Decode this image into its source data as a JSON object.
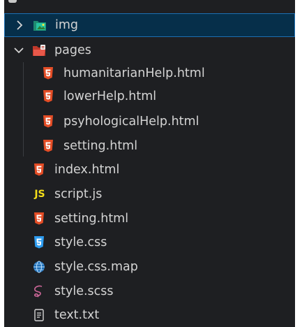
{
  "explorer": {
    "items": [
      {
        "label": "img",
        "type": "folder",
        "state": "collapsed",
        "icon": "image-folder-icon",
        "selected": true
      },
      {
        "label": "pages",
        "type": "folder",
        "state": "expanded",
        "icon": "pages-folder-icon"
      },
      {
        "label": "humanitarianHelp.html",
        "type": "file",
        "icon": "html5-icon"
      },
      {
        "label": "lowerHelp.html",
        "type": "file",
        "icon": "html5-icon"
      },
      {
        "label": "psyhologicalHelp.html",
        "type": "file",
        "icon": "html5-icon"
      },
      {
        "label": "setting.html",
        "type": "file",
        "icon": "html5-icon"
      },
      {
        "label": "index.html",
        "type": "file",
        "icon": "html5-icon"
      },
      {
        "label": "script.js",
        "type": "file",
        "icon": "js-icon"
      },
      {
        "label": "setting.html",
        "type": "file",
        "icon": "html5-icon"
      },
      {
        "label": "style.css",
        "type": "file",
        "icon": "css3-icon"
      },
      {
        "label": "style.css.map",
        "type": "file",
        "icon": "globe-icon"
      },
      {
        "label": "style.scss",
        "type": "file",
        "icon": "sass-icon"
      },
      {
        "label": "text.txt",
        "type": "file",
        "icon": "text-file-icon"
      }
    ],
    "js_badge": "JS"
  },
  "colors": {
    "panel_bg": "#1e1f22",
    "selection_bg": "#062f4a",
    "selection_border": "#1c6fb3",
    "text": "#d4d4d4",
    "html_orange": "#e44d26",
    "js_yellow": "#f5de19",
    "css_blue": "#2d9cf0",
    "sass_pink": "#cd6799"
  }
}
